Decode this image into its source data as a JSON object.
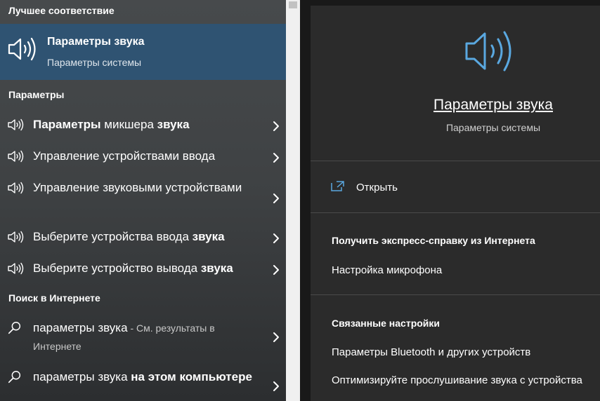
{
  "left": {
    "best_match_header": "Лучшее соответствие",
    "best_match": {
      "title": "Параметры звука",
      "subtitle": "Параметры системы",
      "icon": "speaker-icon"
    },
    "settings_header": "Параметры",
    "settings_items": [
      {
        "parts": [
          {
            "t": "Параметры",
            "b": true
          },
          {
            "t": " микшера ",
            "b": false
          },
          {
            "t": "звука",
            "b": true
          }
        ]
      },
      {
        "parts": [
          {
            "t": "Управление устройствами ввода",
            "b": false
          }
        ]
      },
      {
        "parts": [
          {
            "t": "Управление звуковыми устройствами",
            "b": false
          }
        ]
      },
      {
        "parts": [
          {
            "t": "Выберите устройства ввода ",
            "b": false
          },
          {
            "t": "звука",
            "b": true
          }
        ]
      },
      {
        "parts": [
          {
            "t": "Выберите устройство вывода ",
            "b": false
          },
          {
            "t": "звука",
            "b": true
          }
        ]
      }
    ],
    "web_header": "Поиск в Интернете",
    "web_items": [
      {
        "query": "параметры звука",
        "suffix": " - См. результаты в Интернете"
      },
      {
        "query": "параметры звука",
        "suffix_bold": " на этом компьютере"
      }
    ]
  },
  "right": {
    "title": "Параметры звука",
    "subtitle": "Параметры системы",
    "open_label": "Открыть",
    "help_header": "Получить экспресс-справку из Интернета",
    "help_link": "Настройка микрофона",
    "related_header": "Связанные настройки",
    "related_links": [
      "Параметры Bluetooth и других устройств",
      "Оптимизируйте прослушивание звука с устройства"
    ]
  },
  "colors": {
    "selected_bg": "#2f5372",
    "accent_icon": "#5aa8e0",
    "right_bg": "#2b2b2b"
  }
}
